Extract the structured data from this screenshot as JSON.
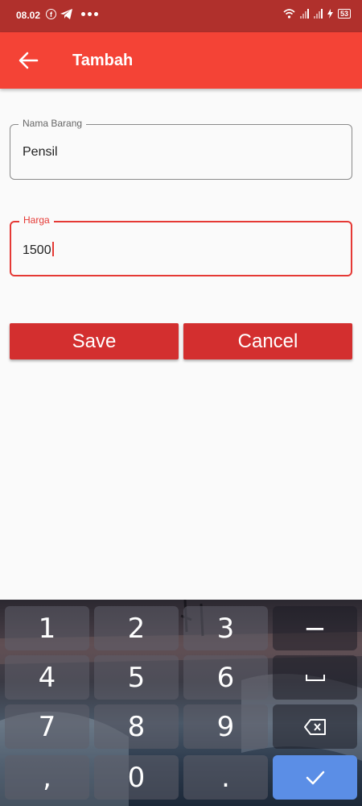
{
  "status_bar": {
    "time": "08.02",
    "facebook_glyph": "f",
    "battery": "53",
    "icons": [
      "facebook-icon",
      "telegram-icon",
      "more-dots-icon",
      "wifi-icon",
      "signal-icon",
      "charging-icon",
      "battery-icon"
    ]
  },
  "app_bar": {
    "title": "Tambah",
    "back_icon": "arrow-left-icon"
  },
  "form": {
    "name_label": "Nama Barang",
    "name_value": "Pensil",
    "price_label": "Harga",
    "price_value": "1500"
  },
  "buttons": {
    "save": "Save",
    "cancel": "Cancel"
  },
  "keyboard": {
    "keys": [
      "1",
      "2",
      "3",
      "−",
      "4",
      "5",
      "6",
      "␣",
      "7",
      "8",
      "9",
      "⌫",
      ",",
      "0",
      ".",
      "✓"
    ],
    "key_icons": {
      "space": "space-icon",
      "backspace": "backspace-icon",
      "done": "check-icon"
    }
  },
  "colors": {
    "status_bar": "#b0302c",
    "app_bar": "#f44336",
    "button": "#d32f2f",
    "focus": "#e53935",
    "done_key": "#5b8ee6"
  }
}
